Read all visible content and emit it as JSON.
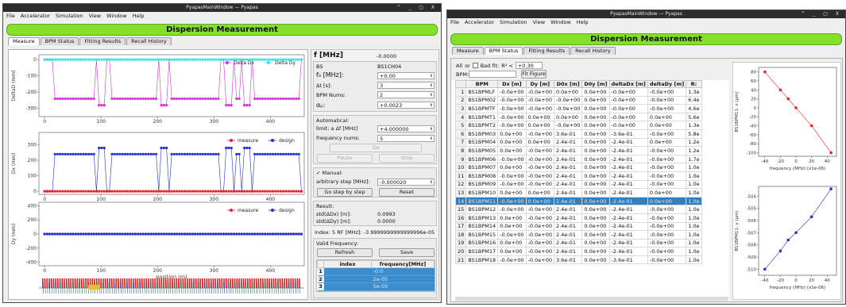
{
  "left_window": {
    "title": "PyapasMainWindow — Pyapas",
    "controls": "^ _ ▢ X",
    "menu": [
      "File",
      "Accelerator",
      "Simulation",
      "View",
      "Window",
      "Help"
    ],
    "banner": "Dispersion Measurement",
    "tabs": [
      "Measure",
      "BPM Status",
      "Fitting Results",
      "Recall History"
    ],
    "plots": {
      "top": {
        "ylabel": "DeltaD (mm)",
        "yticks": [
          "0",
          "-100",
          "-200",
          "-300"
        ],
        "xticks": [
          "0",
          "100",
          "200",
          "300",
          "400"
        ],
        "legend": [
          "Delta Dx",
          "Delta Dy"
        ]
      },
      "mid": {
        "ylabel": "Dx (mm)",
        "yticks": [
          "300",
          "200",
          "100",
          "0"
        ],
        "xticks": [
          "0",
          "100",
          "200",
          "300",
          "400"
        ],
        "legend": [
          "measure",
          "design"
        ]
      },
      "bot": {
        "ylabel": "Dy (mm)",
        "yticks": [
          "400",
          "200",
          "0",
          "-200",
          "-400"
        ],
        "xticks": [
          "0",
          "100",
          "200",
          "300",
          "400"
        ],
        "xlabel": "position (m)",
        "legend": [
          "measure",
          "design"
        ]
      }
    },
    "colors": {
      "delta_dx": "#d62fd6",
      "delta_dy": "#3fe0e0",
      "measure": "#e8202a",
      "design": "#1f2fd4",
      "banner": "#84e02a"
    },
    "panel": {
      "f_label": "f [MHz]",
      "f_value": "-0.0000",
      "bs_label": "BS",
      "bs_value": "BS1CH04",
      "f0_label": "f₀ [MHz]:",
      "f0_value": "+0.00",
      "dt_label": "Δt [s]:",
      "dt_value": "3",
      "bpm_nums_label": "BPM Nums:",
      "bpm_nums_value": "2",
      "ap_label": "αₚ:",
      "ap_value": "+0.0023",
      "auto_label": "Automatical:",
      "limit_label": "limit: a Δf [MHz]",
      "limit_value": "+4.000000",
      "freq_nums_label": "frequency nums:",
      "freq_nums_value": "5",
      "go_btn": "Go",
      "pause_btn": "Pause",
      "stop_btn": "Stop",
      "manual_label": "Manual:",
      "arb_label": "arbitrary step [MHz]:",
      "arb_value": "-0.000020",
      "step_btn": "Go step by step",
      "reset_btn": "Reset",
      "result_label": "Result:",
      "std_dx_label": "std(ΔDx) [m]:",
      "std_dx_value": "0.0993",
      "std_dy_label": "std(ΔDy) [m]:",
      "std_dy_value": "0.0000",
      "index_line": "index:  5    RF [MHz]:  -3.9999999999999996e-05",
      "valid_label": "Valid Frequency:",
      "refresh_btn": "Refresh",
      "save_btn": "Save",
      "vf_headers": [
        "index",
        "frequency[MHz]"
      ],
      "vf_rows": [
        {
          "n": "1",
          "index": "",
          "freq": "-0.0"
        },
        {
          "n": "2",
          "index": "",
          "freq": "2e-05"
        },
        {
          "n": "3",
          "index": "",
          "freq": "5e-05"
        }
      ]
    }
  },
  "right_window": {
    "title": "PyapasMainWindow — Pyapas",
    "controls": "^ _ ▢ X",
    "menu": [
      "File",
      "Accelerator",
      "Simulation",
      "View",
      "Window",
      "Help"
    ],
    "banner": "Dispersion Measurement",
    "tabs": [
      "Measure",
      "BPM Status",
      "Fitting Results",
      "Recall History"
    ],
    "filter": {
      "all": "All",
      "or": "or",
      "badfit": "Bad fit:",
      "r2": "R² <",
      "r2_value": "+0.30",
      "bpm_label": "BPM:",
      "fit_btn": "Fit Figure"
    },
    "table_headers": [
      "",
      "BPM",
      "Dx [m]",
      "Dy [m]",
      "D0x [m]",
      "D0y [m]",
      "deltaDx [m]",
      "deltaDy [m]",
      "R:"
    ],
    "rows": [
      [
        "1",
        "BS1BPMLF",
        "-0.0e+00",
        "-0.0e+00",
        "0.0e+00",
        "0.0e+00",
        "-0.0e+00",
        "-0.0e+00",
        "1.3e"
      ],
      [
        "2",
        "BS1BPM02",
        "-0.0e+00",
        "-0.0e+00",
        "-0.0e+00",
        "0.0e+00",
        "-0.0e+00",
        "-0.0e+00",
        "6.4e"
      ],
      [
        "3",
        "BS1BPMTF",
        "-0.0e+00",
        "-0.0e+00",
        "-0.0e+00",
        "0.0e+00",
        "-0.0e+00",
        "-0.0e+00",
        "4.6e"
      ],
      [
        "4",
        "BS1BPMT1",
        "-0.0e+00",
        "0.0e+00",
        "0.0e+00",
        "0.0e+00",
        "-0.0e+00",
        "0.0e+00",
        "5.6e"
      ],
      [
        "5",
        "BS1BPMT2",
        "-0.0e+00",
        "0.0e+00",
        "-0.0e+00",
        "0.0e+00",
        "-0.0e+00",
        "0.0e+00",
        "1.3e"
      ],
      [
        "6",
        "BS1BPM03",
        "0.0e+00",
        "-0.0e+00",
        "3.6e-01",
        "0.0e+00",
        "-3.6e-01",
        "-0.0e+00",
        "5.8e"
      ],
      [
        "7",
        "BS1BPM04",
        "0.0e+00",
        "0.0e+00",
        "2.4e-01",
        "0.0e+00",
        "-2.4e-01",
        "0.0e+00",
        "1.2e"
      ],
      [
        "8",
        "BS1BPM05",
        "0.0e+00",
        "-0.0e+00",
        "2.4e-01",
        "0.0e+00",
        "-2.4e-01",
        "-0.0e+00",
        "1.2e"
      ],
      [
        "9",
        "BS1BPM06",
        "-0.0e+00",
        "-0.0e+00",
        "2.4e-01",
        "0.0e+00",
        "-2.4e-01",
        "-0.0e+00",
        "1.7e"
      ],
      [
        "10",
        "BS1BPM07",
        "0.0e+00",
        "-0.0e+00",
        "2.4e-01",
        "0.0e+00",
        "-2.4e-01",
        "-0.0e+00",
        "1.0e"
      ],
      [
        "11",
        "BS1BPM08",
        "-0.0e+00",
        "-0.0e+00",
        "2.4e-01",
        "0.0e+00",
        "-2.4e-01",
        "-0.0e+00",
        "1.0e"
      ],
      [
        "12",
        "BS1BPM09",
        "-0.0e+00",
        "-0.0e+00",
        "2.4e-01",
        "0.0e+00",
        "-2.4e-01",
        "-0.0e+00",
        "1.0e"
      ],
      [
        "13",
        "BS1BPM10",
        "0.0e+00",
        "0.0e+00",
        "2.4e-01",
        "0.0e+00",
        "-2.4e-01",
        "0.0e+00",
        "1.0e"
      ],
      [
        "14",
        "BS1BPM11",
        "-0.0e+00",
        "0.0e+00",
        "2.4e-01",
        "0.0e+00",
        "-2.4e-01",
        "0.0e+00",
        "1.0e"
      ],
      [
        "15",
        "BS1BPM12",
        "-0.0e+00",
        "-0.0e+00",
        "2.4e-01",
        "0.0e+00",
        "-2.4e-01",
        "-0.0e+00",
        "1.0e"
      ],
      [
        "16",
        "BS1BPM13",
        "0.0e+00",
        "-0.0e+00",
        "2.4e-01",
        "0.0e+00",
        "-2.4e-01",
        "-0.0e+00",
        "1.0e"
      ],
      [
        "17",
        "BS1BPM14",
        "0.0e+00",
        "-0.0e+00",
        "2.4e-01",
        "0.0e+00",
        "-2.4e-01",
        "-0.0e+00",
        "1.0e"
      ],
      [
        "18",
        "BS1BPM15",
        "-0.0e+00",
        "-0.0e+00",
        "2.4e-01",
        "0.0e+00",
        "-2.4e-01",
        "-0.0e+00",
        "1.0e"
      ],
      [
        "19",
        "BS1BPM16",
        "0.0e+00",
        "-0.0e+00",
        "2.4e-01",
        "0.0e+00",
        "-2.4e-01",
        "-0.0e+00",
        "1.0e"
      ],
      [
        "20",
        "BS1BPM17",
        "0.0e+00",
        "-0.0e+00",
        "2.4e-01",
        "0.0e+00",
        "-2.4e-01",
        "-0.0e+00",
        "1.0e"
      ],
      [
        "21",
        "BS1BPM18",
        "-0.0e+00",
        "-0.0e+00",
        "3.6e-01",
        "0.0e+00",
        "-3.6e-01",
        "-0.0e+00",
        "1.0e"
      ]
    ],
    "selected_row": 13
  },
  "chart_data": [
    {
      "type": "scatter",
      "xlabel": "frequency (MHz) (x1e-06)",
      "ylabel": "BS1BPM11: x (μm)",
      "x": [
        -40,
        -20,
        -10,
        0,
        20,
        45
      ],
      "y": [
        80,
        40,
        20,
        0,
        -40,
        -100
      ],
      "xlim": [
        -48,
        52
      ],
      "ylim": [
        -108,
        90
      ],
      "xticks": [
        "-40",
        "-20",
        "0",
        "20",
        "40"
      ],
      "yticks": [
        "80",
        "60",
        "40",
        "20",
        "0",
        "-20",
        "-40",
        "-60",
        "-80",
        "-100"
      ],
      "color": "#e8202a"
    },
    {
      "type": "scatter",
      "xlabel": "frequency (MHz) (x1e-06)",
      "ylabel": "BS1BPM11: y (μm)",
      "x": [
        -40,
        -20,
        -10,
        0,
        20,
        45
      ],
      "y": [
        -510,
        -508.5,
        -507.6,
        -507,
        -505.7,
        -503.4
      ],
      "xlim": [
        -48,
        52
      ],
      "ylim": [
        -510.5,
        -503.2
      ],
      "xticks": [
        "-40",
        "-20",
        "0",
        "20",
        "40"
      ],
      "yticks": [
        "-504",
        "-505",
        "-506",
        "-507",
        "-508",
        "-509",
        "-510"
      ],
      "color": "#2830c8"
    }
  ]
}
